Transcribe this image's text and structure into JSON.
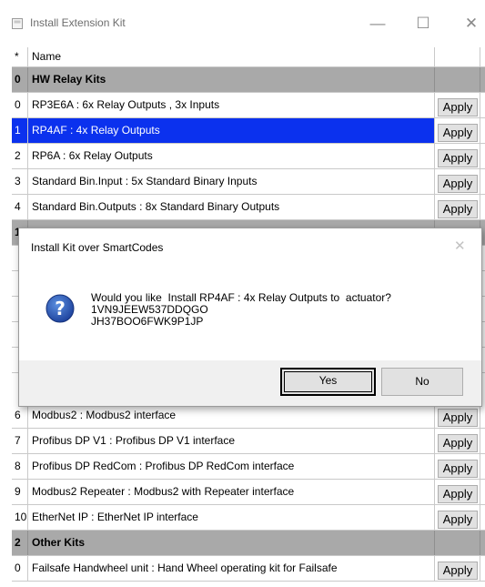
{
  "window": {
    "title": "Install Extension Kit",
    "controls": {
      "minimize": "—",
      "maximize": "☐",
      "close": "✕"
    }
  },
  "grid": {
    "header": {
      "index": "*",
      "name": "Name"
    },
    "rows": [
      {
        "type": "group",
        "index": "0",
        "name": "HW Relay Kits"
      },
      {
        "type": "item",
        "index": "0",
        "name": "RP3E6A : 6x Relay Outputs , 3x Inputs",
        "button": "Apply"
      },
      {
        "type": "item",
        "index": "1",
        "name": "RP4AF : 4x Relay Outputs",
        "button": "Apply",
        "selected": true
      },
      {
        "type": "item",
        "index": "2",
        "name": "RP6A : 6x Relay Outputs",
        "button": "Apply"
      },
      {
        "type": "item",
        "index": "3",
        "name": "Standard Bin.Input : 5x Standard Binary Inputs",
        "button": "Apply"
      },
      {
        "type": "item",
        "index": "4",
        "name": "Standard Bin.Outputs : 8x Standard Binary Outputs",
        "button": "Apply"
      },
      {
        "type": "group",
        "index": "1",
        "name": ""
      },
      {
        "type": "item",
        "index": "",
        "name": "",
        "button": ""
      },
      {
        "type": "item",
        "index": "",
        "name": "",
        "button": ""
      },
      {
        "type": "item",
        "index": "",
        "name": "",
        "button": ""
      },
      {
        "type": "item",
        "index": "",
        "name": "",
        "button": ""
      },
      {
        "type": "item",
        "index": "",
        "name": "",
        "button": ""
      },
      {
        "type": "item",
        "index": "6",
        "name": "Modbus2 : Modbus2 interface",
        "button": "Apply"
      },
      {
        "type": "item",
        "index": "7",
        "name": "Profibus DP V1 : Profibus DP V1 interface",
        "button": "Apply"
      },
      {
        "type": "item",
        "index": "8",
        "name": "Profibus DP RedCom : Profibus DP RedCom interface",
        "button": "Apply"
      },
      {
        "type": "item",
        "index": "9",
        "name": "Modbus2 Repeater : Modbus2 with Repeater interface",
        "button": "Apply"
      },
      {
        "type": "item",
        "index": "10",
        "name": "EtherNet IP : EtherNet IP interface",
        "button": "Apply"
      },
      {
        "type": "group",
        "index": "2",
        "name": "Other Kits"
      },
      {
        "type": "item",
        "index": "0",
        "name": "Failsafe Handwheel unit : Hand Wheel operating kit for Failsafe",
        "button": "Apply"
      }
    ]
  },
  "dialog": {
    "title": "Install Kit over SmartCodes",
    "close": "✕",
    "icon": "question-icon",
    "message": "Would you like  Install RP4AF : 4x Relay Outputs to  actuator?\n1VN9JEEW537DDQGO\nJH37BOO6FWK9P1JP",
    "yes_label": "Yes",
    "no_label": "No"
  },
  "colors": {
    "selection": "#0b31ee",
    "group_row": "#a9a9a9",
    "button_face": "#e1e1e1",
    "dialog_footer": "#f0f0f0"
  }
}
